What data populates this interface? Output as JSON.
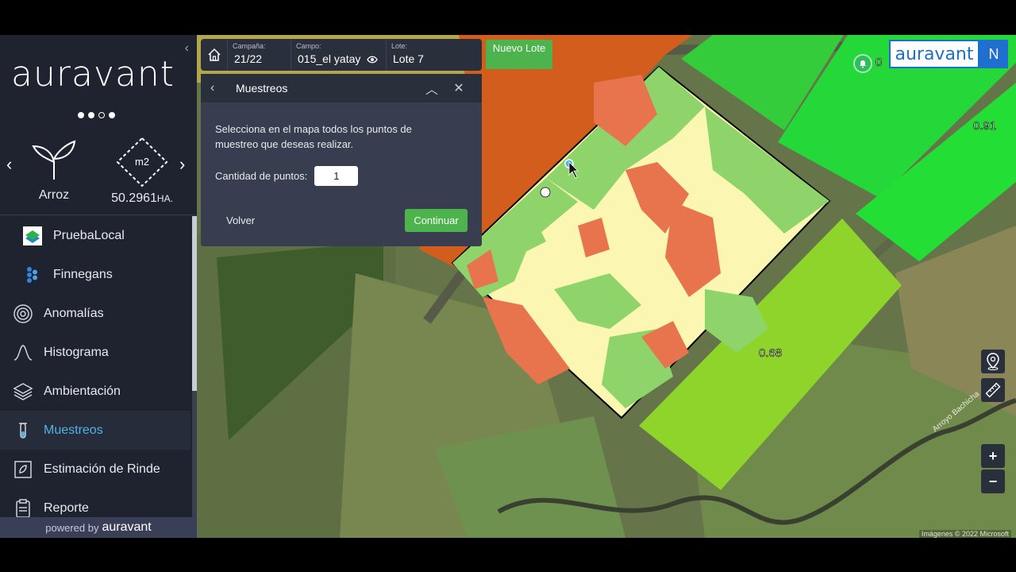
{
  "sidebar": {
    "brand": "auravant",
    "crop_name": "Arroz",
    "area_icon_label": "m2",
    "area_value": "50.2961",
    "area_unit": "HA.",
    "menu": [
      {
        "label": "PruebaLocal",
        "icon": "prueba-local-icon"
      },
      {
        "label": "Finnegans",
        "icon": "finnegans-icon"
      },
      {
        "label": "Anomalías",
        "icon": "radar-icon"
      },
      {
        "label": "Histograma",
        "icon": "histogram-icon"
      },
      {
        "label": "Ambientación",
        "icon": "layers-icon"
      },
      {
        "label": "Muestreos",
        "icon": "test-tube-icon"
      },
      {
        "label": "Estimación de Rinde",
        "icon": "yield-icon"
      },
      {
        "label": "Reporte",
        "icon": "report-icon"
      }
    ],
    "footer_prefix": "powered by",
    "footer_brand": "auravant"
  },
  "topbar": {
    "campaign_label": "Campaña:",
    "campaign_value": "21/22",
    "field_label": "Campo:",
    "field_value": "015_el yatay",
    "lot_label": "Lote:",
    "lot_value": "Lote 7",
    "new_lot_button": "Nuevo Lote"
  },
  "dialog": {
    "title": "Muestreos",
    "instructions": "Selecciona en el mapa todos los puntos de muestreo que deseas realizar.",
    "points_label": "Cantidad de puntos:",
    "points_value": "1",
    "back_button": "Volver",
    "continue_button": "Continuar"
  },
  "brand_box": {
    "name": "auravant",
    "letter": "N"
  },
  "map": {
    "lot_values": [
      "0.91",
      "0.68"
    ],
    "partial_value": "0",
    "river_label": "Arroyo Bachicha",
    "attribution": "Imágenes © 2022 Microsoft",
    "zoom_in": "+",
    "zoom_out": "−"
  },
  "colors": {
    "accent_green": "#4db34d",
    "active_blue": "#4fb3e8",
    "zone_red": "#e8744e",
    "zone_yellow": "#fbf6b2",
    "zone_green": "#8fd46a"
  }
}
